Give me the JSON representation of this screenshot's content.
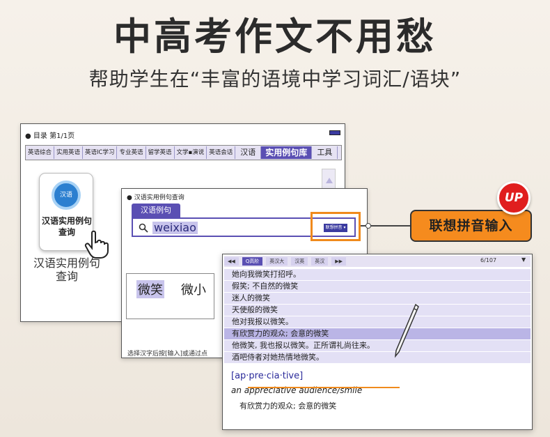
{
  "headline": "中高考作文不用愁",
  "subheadline": "帮助学生在“丰富的语境中学习词汇/语块”",
  "screen1": {
    "top_label": "● 目录 第1/1页",
    "tabs": [
      "英语综合",
      "实用英语",
      "英语IC学习",
      "专业英语",
      "留学英语",
      "文学▪演说",
      "英语会话",
      "汉语",
      "实用例句库",
      "工具"
    ],
    "selected_tab": "实用例句库",
    "app_icon_badge": "汉语",
    "app_icon_label_line1": "汉语实用例句",
    "app_icon_label_line2": "查询",
    "app_caption": "汉语实用例句\n查询"
  },
  "screen2": {
    "title": "● 汉语实用例句查询",
    "tab_label": "汉语例句",
    "search_value": "weixiao",
    "mode_label": "联想拼音 ▾",
    "results": [
      "微笑",
      "微小"
    ],
    "footer": "选择汉字后按[输入]或通过点"
  },
  "callout": {
    "label": "联想拼音输入",
    "badge": "UP"
  },
  "screen3": {
    "nav": [
      "◀◀",
      "Q高阶",
      "英汉大",
      "汉英",
      "英汉",
      "▶▶"
    ],
    "nav_selected": "Q高阶",
    "page": "6/107",
    "lines": [
      "她向我微笑打招呼。",
      "假笑; 不自然的微笑",
      "迷人的微笑",
      "天使般的微笑",
      "他对我报以微笑。",
      "有欣赏力的观众; 会意的微笑",
      "他微笑, 我也报以微笑。正所谓礼尚往来。",
      "酒吧侍者对她热情地微笑。"
    ],
    "highlighted_line": 5,
    "phonetic": "[ap·pre·cia·tive]",
    "example": "an appreciative audience/smile",
    "translation": "有欣赏力的观众; 会意的微笑"
  }
}
